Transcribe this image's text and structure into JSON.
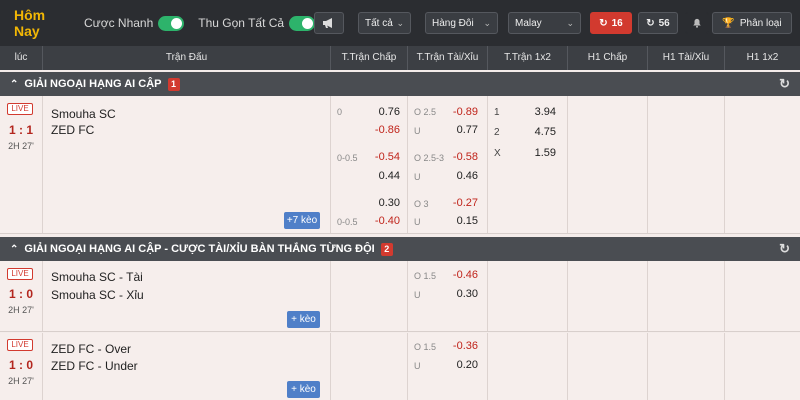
{
  "topbar": {
    "title": "Hôm Nay",
    "quick_bet_label": "Cược Nhanh",
    "collapse_all_label": "Thu Gọn Tất Cả",
    "filter_all": "Tất cả",
    "sort": "Hàng Đôi",
    "odds_type": "Malay",
    "live_count": "16",
    "refresh_count": "56",
    "category_label": "Phân loại"
  },
  "columns": [
    "lúc",
    "Trận Đấu",
    "T.Trận Chấp",
    "T.Trận Tài/Xỉu",
    "T.Trận 1x2",
    "H1 Chấp",
    "H1 Tài/Xỉu",
    "H1 1x2"
  ],
  "leagues": [
    {
      "name": "GIẢI NGOẠI HẠNG AI CẬP",
      "count": "1"
    },
    {
      "name": "GIẢI NGOẠI HẠNG AI CẬP - CƯỢC TÀI/XỈU BÀN THẮNG TỪNG ĐỘI",
      "count": "2"
    }
  ],
  "match1": {
    "live": "LIVE",
    "score": "1 : 1",
    "time": "2H 27'",
    "home": "Smouha SC",
    "away": "ZED FC",
    "hdp_rows": [
      {
        "line": "0",
        "home": "0.76",
        "away": "-0.86"
      },
      {
        "line": "0-0.5",
        "home": "-0.54",
        "away": "0.44"
      },
      {
        "line": "0-0.5",
        "home": "0.30",
        "away": "-0.40"
      }
    ],
    "ou_rows": [
      {
        "line": "O 2.5",
        "under": "U",
        "over_odd": "-0.89",
        "under_odd": "0.77"
      },
      {
        "line": "O 2.5-3",
        "under": "U",
        "over_odd": "-0.58",
        "under_odd": "0.46"
      },
      {
        "line": "O 3",
        "under": "U",
        "over_odd": "-0.27",
        "under_odd": "0.15"
      }
    ],
    "x12": [
      {
        "label": "1",
        "odd": "3.94"
      },
      {
        "label": "2",
        "odd": "4.75"
      },
      {
        "label": "X",
        "odd": "1.59"
      }
    ],
    "more": "+7 kèo"
  },
  "match2": {
    "live": "LIVE",
    "score": "1 : 0",
    "time": "2H 27'",
    "home": "Smouha SC - Tài",
    "away": "Smouha SC - Xỉu",
    "ou": {
      "line": "O 1.5",
      "under": "U",
      "over_odd": "-0.46",
      "under_odd": "0.30"
    },
    "more": "+ kèo"
  },
  "match3": {
    "live": "LIVE",
    "score": "1 : 0",
    "time": "2H 27'",
    "home": "ZED FC - Over",
    "away": "ZED FC - Under",
    "ou": {
      "line": "O 1.5",
      "under": "U",
      "over_odd": "-0.36",
      "under_odd": "0.20"
    },
    "more": "+ kèo"
  }
}
